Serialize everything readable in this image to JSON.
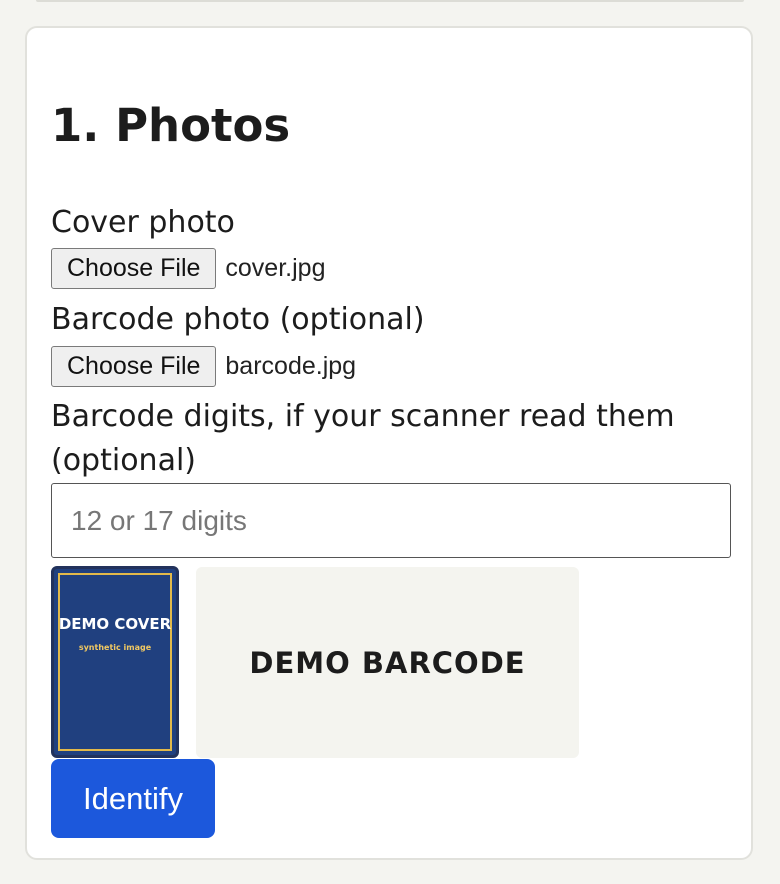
{
  "section": {
    "title": "1. Photos"
  },
  "cover_photo": {
    "label": "Cover photo",
    "button_label": "Choose File",
    "file_name": "cover.jpg"
  },
  "barcode_photo": {
    "label": "Barcode photo (optional)",
    "button_label": "Choose File",
    "file_name": "barcode.jpg"
  },
  "barcode_digits": {
    "label_line1": "Barcode digits, if your scanner read them",
    "label_line2": "(optional)",
    "placeholder": "12 or 17 digits",
    "value": ""
  },
  "previews": {
    "cover": {
      "title": "DEMO COVER",
      "subtitle": "synthetic image"
    },
    "barcode": {
      "title": "DEMO BARCODE"
    }
  },
  "actions": {
    "identify_label": "Identify"
  },
  "colors": {
    "page_background": "#f4f4f0",
    "card_background": "#ffffff",
    "accent_button": "#1c58dc",
    "cover_background": "#20407f",
    "cover_frame": "#e2b94a"
  }
}
